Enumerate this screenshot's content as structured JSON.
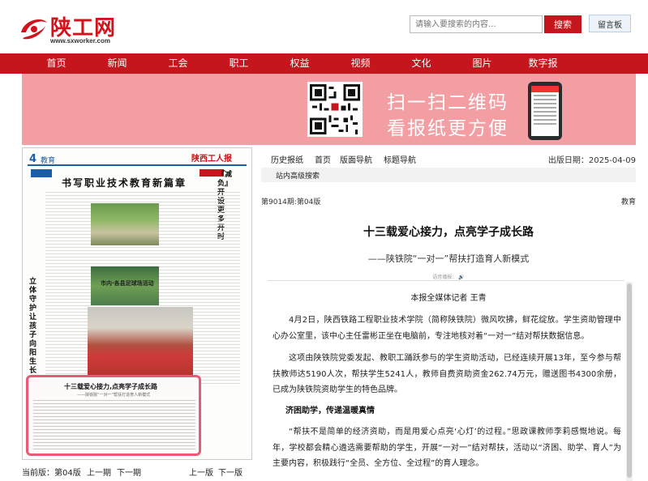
{
  "header": {
    "logo_text": "陕工网",
    "logo_url": "www.sxworker.com",
    "search_placeholder": "请输入要搜索的内容...",
    "search_button": "搜索",
    "guestbook_button": "留言板"
  },
  "nav": {
    "items": [
      "首页",
      "新闻",
      "工会",
      "职工",
      "权益",
      "视频",
      "文化",
      "图片",
      "数字报"
    ]
  },
  "banner": {
    "line1": "扫一扫二维码",
    "line2": "看报纸更方便"
  },
  "paper": {
    "page_number": "4",
    "section": "教育",
    "masthead": "陕西工人报",
    "headline": "书写职业技术教育新篇章",
    "vertical_title_right": "『减负』开设更多开时",
    "vertical_title_left": "立体守护让孩子向阳生长",
    "photo_caption": "市内·各县足球场活动",
    "highlight_title": "十三载爱心接力,点亮学子成长路",
    "highlight_subtitle": "——陕铁院“一对一”帮扶打造育人新模式"
  },
  "page_nav": {
    "current": "当前版：第04版",
    "prev_issue": "上一期",
    "next_issue": "下一期",
    "prev_page": "上一版",
    "next_page": "下一版"
  },
  "toolbar": {
    "history": "历史报纸",
    "home": "首页",
    "page_nav": "版面导航",
    "title_nav": "标题导航",
    "date": "出版日期：2025-04-09",
    "site_search": "站内高级搜索"
  },
  "article": {
    "issue": "第9014期:第04版",
    "section": "教育",
    "title": "十三载爱心接力，点亮学子成长路",
    "subtitle": "——陕铁院“一对一”帮扶打造育人新模式",
    "voice": "语音播报：",
    "byline": "本报全媒体记者  王青",
    "p1": "4月2日，陕西铁路工程职业技术学院（简称陕铁院）微风吹拂，鲜花绽放。学生资助管理中心办公室里，该中心主任雷彬正坐在电脑前，专注地核对着“一对一”结对帮扶数据信息。",
    "p2": "这项由陕铁院党委发起、教职工踊跃参与的学生资助活动，已经连续开展13年，至今参与帮扶教师达5190人次，帮扶学生5241人，教师自费资助资金262.74万元，赠送图书4300余册，已成为陕铁院资助学生的特色品牌。",
    "heading": "济困助学，传递温暖真情",
    "p3": "“帮扶不是简单的经济资助，而是用爱心点亮‘心灯’的过程。”思政课教师李莉感慨地说。每年，学校都会精心遴选需要帮助的学生，开展“一对一”结对帮扶，活动以“济困、助学、育人”为主要内容，积极践行“全员、全方位、全过程”的育人理念。"
  },
  "colors": {
    "brand_red": "#c4161c",
    "banner_pink": "#f29ea3",
    "highlight_border": "#e85a78"
  }
}
